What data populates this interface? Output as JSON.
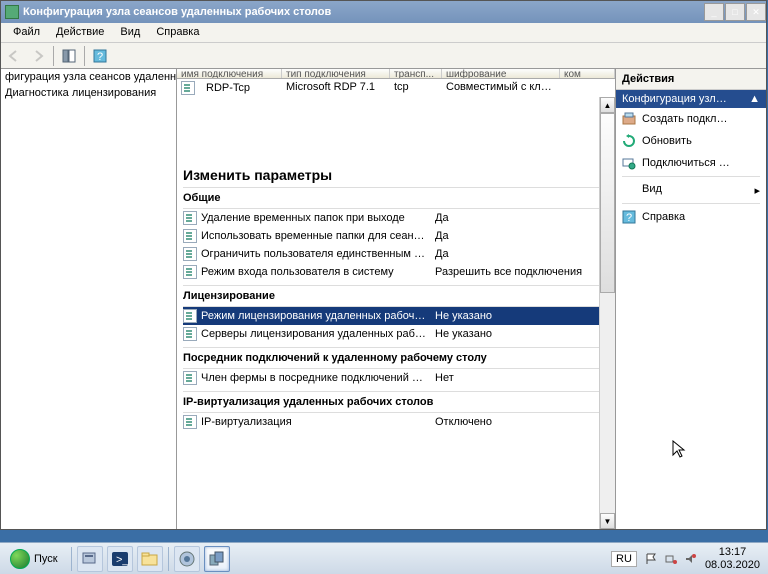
{
  "window": {
    "title": "Конфигурация узла сеансов удаленных рабочих столов"
  },
  "menu": {
    "file": "Файл",
    "action": "Действие",
    "view": "Вид",
    "help": "Справка"
  },
  "tree": {
    "row0": "фигурация узла сеансов удаленны",
    "row1": "Диагностика лицензирования"
  },
  "cols": {
    "c0": "имя подключения",
    "c1": "тип подключения",
    "c2": "трансп...",
    "c3": "шифрование",
    "c4": "ком"
  },
  "conn": {
    "name": "RDP-Tcp",
    "type": "Microsoft RDP 7.1",
    "transport": "tcp",
    "enc": "Совместимый с кл…"
  },
  "editParamsTitle": "Изменить параметры",
  "sections": {
    "general": "Общие",
    "licensing": "Лицензирование",
    "broker": "Посредник подключений к удаленному рабочему столу",
    "ipvirt": "IP-виртуализация удаленных рабочих столов"
  },
  "items": {
    "g0": {
      "lbl": "Удаление временных папок при выходе",
      "val": "Да"
    },
    "g1": {
      "lbl": "Использовать временные папки для сеан…",
      "val": "Да"
    },
    "g2": {
      "lbl": "Ограничить пользователя единственным …",
      "val": "Да"
    },
    "g3": {
      "lbl": "Режим входа пользователя в систему",
      "val": "Разрешить все подключения"
    },
    "l0": {
      "lbl": "Режим лицензирования удаленных рабочи…",
      "val": "Не указано"
    },
    "l1": {
      "lbl": "Серверы лицензирования удаленных рабо…",
      "val": "Не указано"
    },
    "b0": {
      "lbl": "Член фермы в посреднике подключений к…",
      "val": "Нет"
    },
    "v0": {
      "lbl": "IP-виртуализация",
      "val": "Отключено"
    }
  },
  "actions": {
    "header": "Действия",
    "sub": "Конфигурация узл…",
    "a0": "Создать подкл…",
    "a1": "Обновить",
    "a2": "Подключиться …",
    "a3": "Вид",
    "a4": "Справка"
  },
  "taskbar": {
    "start": "Пуск",
    "lang": "RU",
    "time": "13:17",
    "date": "08.03.2020"
  }
}
